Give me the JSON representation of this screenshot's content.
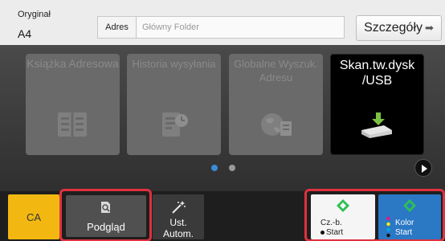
{
  "header": {
    "original_label": "Oryginał",
    "original_value": "A4",
    "address_label": "Adres",
    "address_value": "Główny Folder",
    "details_label": "Szczegóły"
  },
  "tiles": [
    {
      "label": "Książka Adresowa",
      "icon": "address-book-icon",
      "enabled": false
    },
    {
      "label": "Historia wysyłania",
      "icon": "send-history-icon",
      "enabled": false
    },
    {
      "label": "Globalne Wyszuk. Adresu",
      "icon": "global-address-search-icon",
      "enabled": false
    },
    {
      "label": "Skan.tw.dysk /USB",
      "icon": "usb-drive-icon",
      "enabled": true
    }
  ],
  "pager": {
    "current": 1,
    "total": 2
  },
  "bottom": {
    "ca_label": "CA",
    "preview_label": "Podgląd",
    "auto_label_1": "Ust.",
    "auto_label_2": "Autom.",
    "bw_label_1": "Cz.-b.",
    "bw_label_2": "Start",
    "color_label_1": "Kolor",
    "color_label_2": "Start"
  },
  "colors": {
    "highlight_frame": "#e0313e",
    "ca_button": "#f2b811",
    "color_start": "#2b78c5",
    "start_diamond": "#2dbf55",
    "active_dot": "#3a8cd8"
  }
}
